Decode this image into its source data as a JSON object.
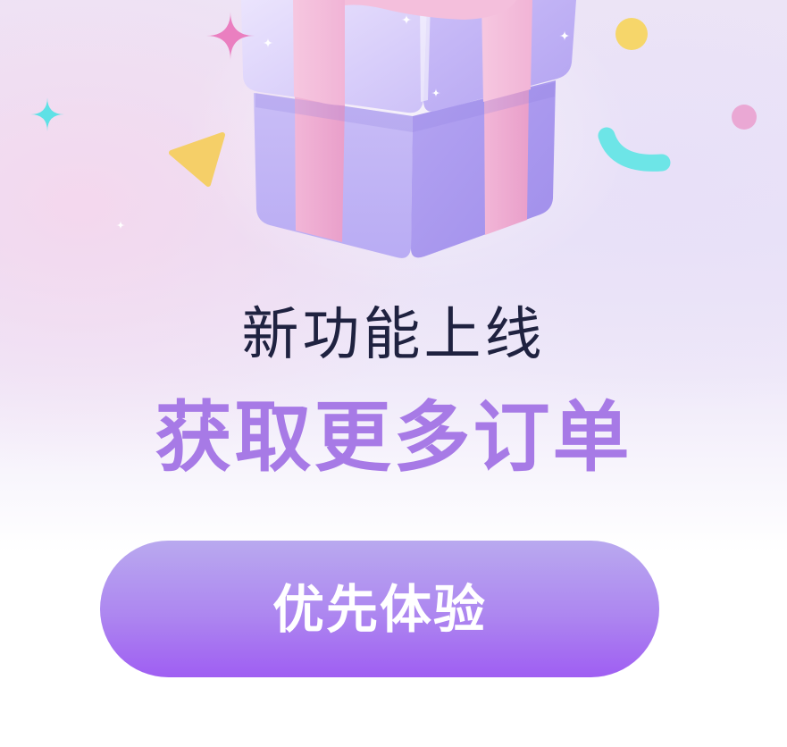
{
  "popup": {
    "title": "新功能上线",
    "headline": "获取更多订单",
    "cta_label": "优先体验"
  },
  "illustration": {
    "main_icon": "gift-box-icon",
    "decoration_icons": [
      "sparkle-star-icon",
      "triangle-confetti-icon",
      "circle-confetti-icon",
      "arc-confetti-icon"
    ]
  },
  "colors": {
    "title": "#1f2240",
    "headline": "#a77ae6",
    "button_top": "#b9a9ef",
    "button_bottom": "#9f5ef2",
    "button_text": "#ffffff",
    "ribbon": "#f3b8d8",
    "box": "#c5b8f6"
  }
}
